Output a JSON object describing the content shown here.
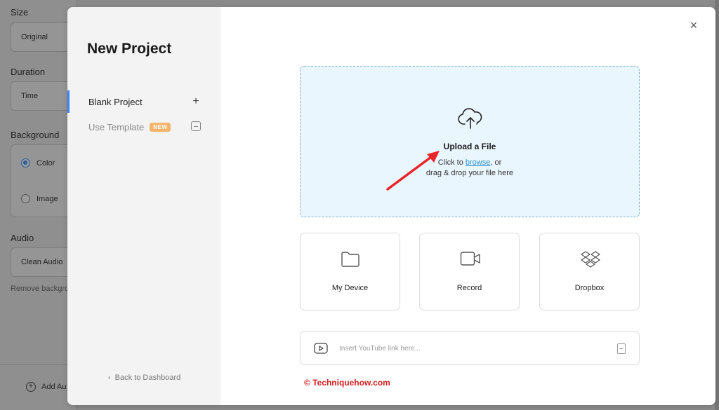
{
  "background_app": {
    "size_label": "Size",
    "size_value": "Original",
    "duration_label": "Duration",
    "duration_value": "Time",
    "background_label": "Background",
    "bg_option_color": "Color",
    "bg_option_image": "Image",
    "audio_label": "Audio",
    "audio_value": "Clean Audio",
    "audio_hint": "Remove backgro",
    "add_label": "Add Au"
  },
  "modal": {
    "title": "New Project",
    "close_icon": "×",
    "sidebar": {
      "items": [
        {
          "label": "Blank Project",
          "trail": "+",
          "active": true
        },
        {
          "label": "Use Template",
          "badge": "NEW",
          "active": false
        }
      ],
      "back_label": "Back to Dashboard",
      "back_chevron": "‹"
    },
    "upload": {
      "title": "Upload a File",
      "line1_prefix": "Click to ",
      "line1_link": "browse",
      "line1_suffix": ", or",
      "line2": "drag & drop your file here"
    },
    "sources": [
      {
        "label": "My Device",
        "icon": "folder-icon"
      },
      {
        "label": "Record",
        "icon": "video-camera-icon"
      },
      {
        "label": "Dropbox",
        "icon": "dropbox-icon"
      }
    ],
    "youtube": {
      "placeholder": "Insert YouTube link here...",
      "value": ""
    }
  },
  "watermark": "© Techniquehow.com",
  "colors": {
    "accent": "#3b82f6",
    "upload_bg": "#eaf6fd",
    "badge": "#f3b46b",
    "link": "#2b8fd6",
    "annotation_arrow": "#e8262a"
  }
}
